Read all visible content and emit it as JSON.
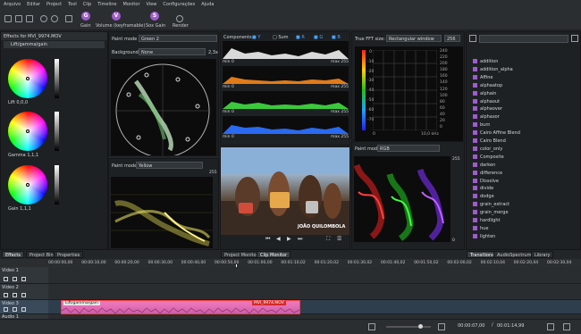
{
  "menu": [
    "Arquivo",
    "Editar",
    "Project",
    "Tool",
    "Clip",
    "Timeline",
    "Monitor",
    "View",
    "Configurações",
    "Ajuda"
  ],
  "toolbar": {
    "gain": "Gain",
    "volume": "Volume (keyframable)",
    "sox_gain": "Sox Gain",
    "render": "Render"
  },
  "effects_panel": {
    "title": "Effects for MVI_9974.MOV",
    "effect": "Lift/gamma/gain",
    "lift": "Lift 0,0,0",
    "gamma": "Gamma 1,1,1",
    "gain": "Gain 1,1,1",
    "tabs": [
      "Effects",
      "Project Bin",
      "Properties"
    ]
  },
  "vectorscope": {
    "paint_mode_label": "Paint mode",
    "paint_mode_value": "Green 2",
    "background_label": "Background",
    "background_value": "None",
    "zoom": "2,3x"
  },
  "waveform": {
    "paint_mode_label": "Paint mode",
    "paint_mode_value": "Yellow",
    "max": "255"
  },
  "histogram": {
    "title": "Components",
    "options": [
      "Y",
      "Sum",
      "R",
      "G",
      "B"
    ],
    "rows": [
      {
        "min": "min",
        "minv": "0",
        "max": "max",
        "maxv": "255",
        "color": "#e6e6e6"
      },
      {
        "min": "min",
        "minv": "0",
        "max": "max",
        "maxv": "255",
        "color": "#e07b1a"
      },
      {
        "min": "min",
        "minv": "0",
        "max": "max",
        "maxv": "255",
        "color": "#3cc83c"
      },
      {
        "min": "min",
        "minv": "0",
        "max": "max",
        "maxv": "255",
        "color": "#2a6af0"
      }
    ]
  },
  "monitor": {
    "caption": "JOÃO QUILOMBOLA",
    "tabs": [
      "Project Monitor",
      "Clip Monitor"
    ]
  },
  "fft": {
    "title": "True FFT size:",
    "window": "Rectangular window",
    "size": "256",
    "db_labels": [
      "0",
      "-10",
      "-20",
      "-30",
      "-40",
      "-50",
      "-60",
      "-70"
    ],
    "freq_labels": [
      "0",
      "10,0 kHz"
    ],
    "right_labels": [
      "240",
      "220",
      "200",
      "180",
      "160",
      "140",
      "120",
      "100",
      "80",
      "60",
      "40",
      "20",
      "0"
    ]
  },
  "rgb_parade": {
    "paint_mode_label": "Paint mode",
    "paint_mode_value": "RGB",
    "max": "255",
    "min": "0"
  },
  "fx_list": {
    "items": [
      "addition",
      "addition_alpha",
      "Affine",
      "alphaatop",
      "alphain",
      "alphaout",
      "alphaover",
      "alphaxor",
      "burn",
      "Cairo Affine Blend",
      "Cairo Blend",
      "color_only",
      "Composite",
      "darken",
      "difference",
      "Dissolve",
      "divide",
      "dodge",
      "grain_extract",
      "grain_merge",
      "hardlight",
      "hue",
      "lighten"
    ],
    "tabs": [
      "Transitions",
      "AudioSpectrum",
      "Library"
    ]
  },
  "timeline": {
    "ticks": [
      "00:00:00,00",
      "00:00:10,00",
      "00:00:20,00",
      "00:00:30,00",
      "00:00:40,00",
      "00:00:50,00",
      "00:01:00,00",
      "00:01:10,02",
      "00:01:20,02",
      "00:01:30,02",
      "00:01:40,02",
      "00:01:50,02",
      "00:02:00,02",
      "00:02:10,04",
      "00:02:20,04",
      "00:02:30,04"
    ],
    "tracks": [
      "Video 1",
      "Video 2",
      "Video 3",
      "Audio 1"
    ],
    "clip_effect": "Lift/gamma/gain",
    "clip_name": "MVI_9974.MOV",
    "timecode": "00:00:07,00",
    "duration": "00:01:14,99"
  }
}
